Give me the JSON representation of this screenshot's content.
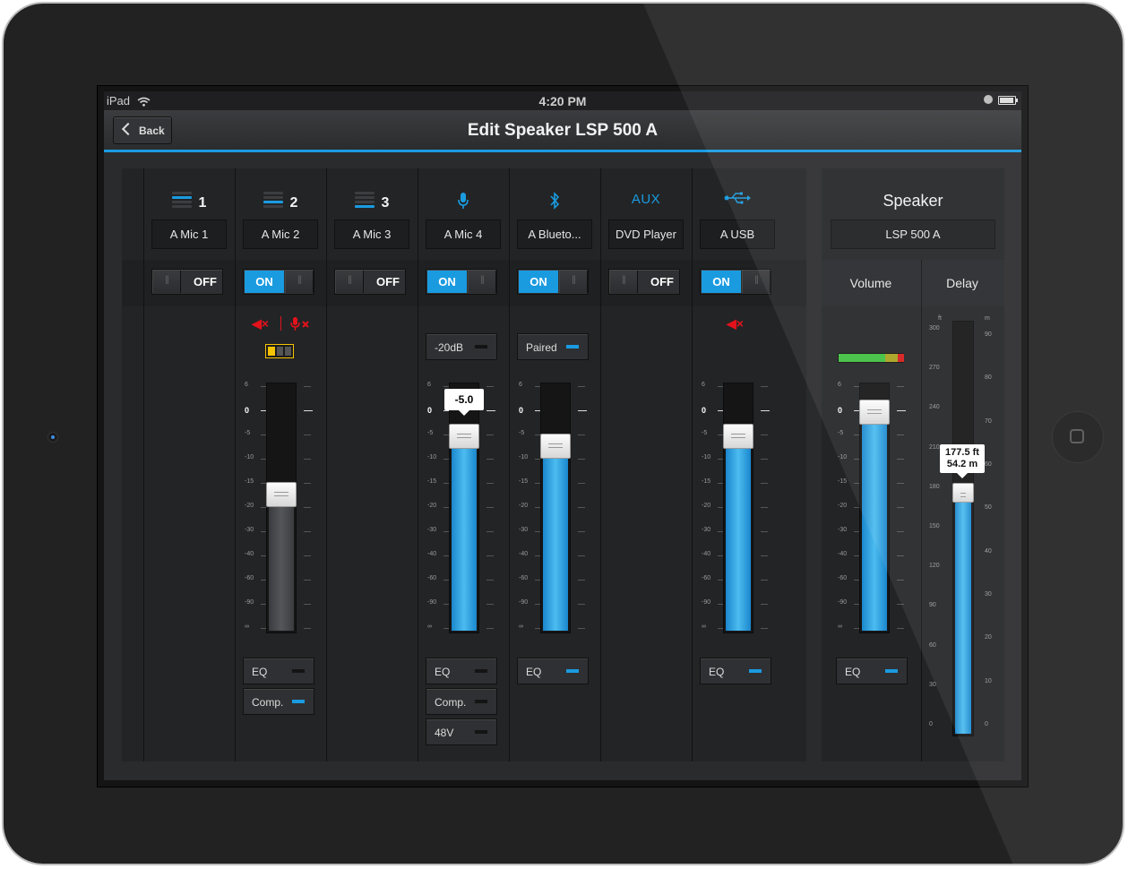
{
  "status_bar": {
    "device": "iPad",
    "time": "4:20 PM"
  },
  "nav": {
    "back_label": "Back",
    "title": "Edit Speaker LSP 500 A"
  },
  "channels": [
    {
      "number": "1",
      "icon": "input-stack-icon",
      "name": "A Mic 1",
      "toggle": "OFF"
    },
    {
      "number": "2",
      "icon": "input-stack-icon",
      "name": "A Mic 2",
      "toggle": "ON",
      "fader_value": -17,
      "buttons": [
        "EQ",
        "Comp."
      ]
    },
    {
      "number": "3",
      "icon": "input-stack-icon",
      "name": "A Mic 3",
      "toggle": "OFF"
    },
    {
      "icon": "microphone-icon",
      "name": "A Mic 4",
      "toggle": "ON",
      "pad": "-20dB",
      "fader_value": -5.0,
      "fader_label": "-5.0",
      "buttons": [
        "EQ",
        "Comp.",
        "48V"
      ]
    },
    {
      "icon": "bluetooth-icon",
      "name": "A Blueto...",
      "toggle": "ON",
      "pad": "Paired",
      "fader_value": -7,
      "buttons": [
        "EQ"
      ]
    },
    {
      "icon_text": "AUX",
      "name": "DVD Player",
      "toggle": "OFF"
    },
    {
      "icon": "usb-icon",
      "name": "A USB",
      "toggle": "ON",
      "fader_value": -5,
      "buttons": [
        "EQ"
      ]
    }
  ],
  "toggle_labels": {
    "on": "ON",
    "off": "OFF"
  },
  "fader_scale": [
    "6",
    "0",
    "-5",
    "-10",
    "-15",
    "-20",
    "-30",
    "-40",
    "-60",
    "-90",
    "∞"
  ],
  "speaker": {
    "title": "Speaker",
    "name": "LSP 500 A",
    "volume_label": "Volume",
    "delay_label": "Delay",
    "volume_value": 0,
    "volume_eq": "EQ",
    "delay_ft": 177.5,
    "delay_label_ft": "177.5 ft",
    "delay_label_m": "54.2 m",
    "delay_unit_ft": "ft",
    "delay_unit_m": "m",
    "ft_scale": [
      "300",
      "270",
      "240",
      "210",
      "180",
      "150",
      "120",
      "90",
      "60",
      "30",
      "0"
    ],
    "m_scale": [
      "90",
      "80",
      "70",
      "60",
      "50",
      "40",
      "30",
      "20",
      "10",
      "0"
    ]
  },
  "colors": {
    "accent": "#1a9be0",
    "mute": "#e3121b",
    "battery": "#f5c400"
  }
}
